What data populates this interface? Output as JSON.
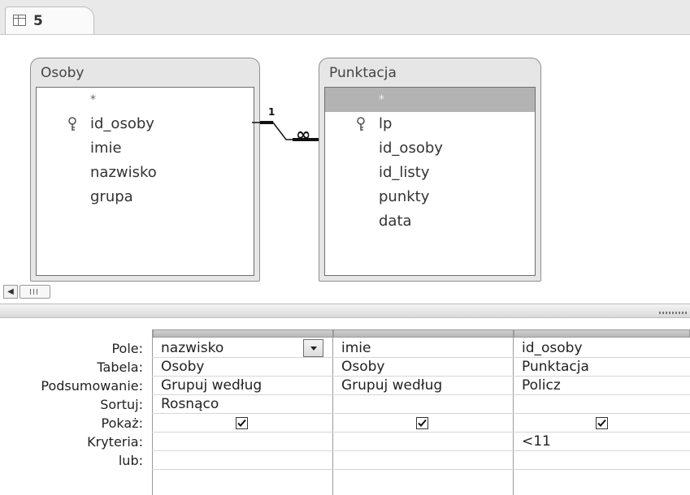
{
  "tab": {
    "label": "5",
    "icon": "query-icon"
  },
  "tables": [
    {
      "name": "Osoby",
      "fields": [
        "*",
        "id_osoby",
        "imie",
        "nazwisko",
        "grupa"
      ],
      "key_field": "id_osoby"
    },
    {
      "name": "Punktacja",
      "fields": [
        "*",
        "lp",
        "id_osoby",
        "id_listy",
        "punkty",
        "data"
      ],
      "key_field": "lp",
      "selected_field": "*"
    }
  ],
  "relationship": {
    "one_side": "1",
    "many_side": "∞"
  },
  "grid": {
    "row_labels": [
      "Pole:",
      "Tabela:",
      "Podsumowanie:",
      "Sortuj:",
      "Pokaż:",
      "Kryteria:",
      "lub:"
    ],
    "columns": [
      {
        "pole": "nazwisko",
        "tabela": "Osoby",
        "podsumowanie": "Grupuj według",
        "sortuj": "Rosnąco",
        "pokaz": true,
        "kryteria": "",
        "lub": ""
      },
      {
        "pole": "imie",
        "tabela": "Osoby",
        "podsumowanie": "Grupuj według",
        "sortuj": "",
        "pokaz": true,
        "kryteria": "",
        "lub": ""
      },
      {
        "pole": "id_osoby",
        "tabela": "Punktacja",
        "podsumowanie": "Policz",
        "sortuj": "",
        "pokaz": true,
        "kryteria": "<11",
        "lub": ""
      }
    ]
  },
  "colors": {
    "background": "#ffffff",
    "panel": "#e6e6e6",
    "selected_field": "#b3b3b3"
  }
}
